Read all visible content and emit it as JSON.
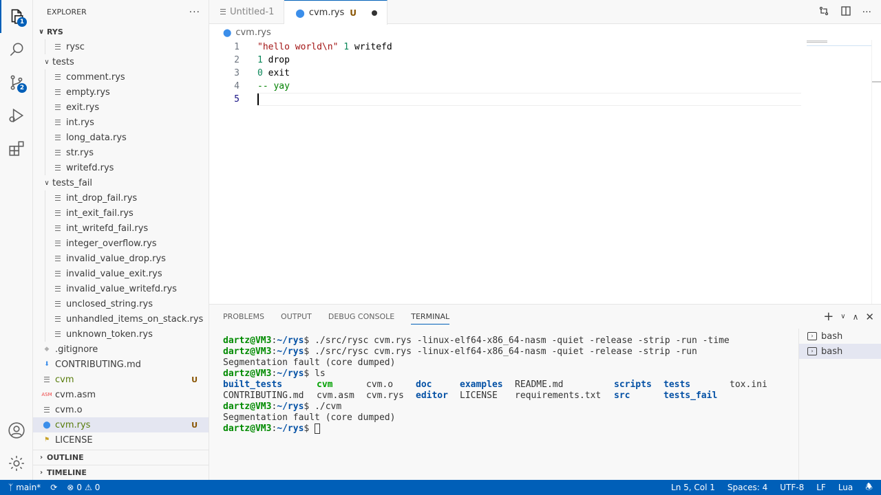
{
  "activity": {
    "explorer_badge": "1",
    "scm_badge": "2"
  },
  "sidebar": {
    "title": "EXPLORER",
    "more": "···",
    "root": "RYS",
    "items": [
      {
        "name": "rysc",
        "depth": 1,
        "kind": "file",
        "icon": "lines"
      },
      {
        "name": "tests",
        "depth": 0,
        "kind": "folder",
        "open": true
      },
      {
        "name": "comment.rys",
        "depth": 1,
        "kind": "file",
        "icon": "lines"
      },
      {
        "name": "empty.rys",
        "depth": 1,
        "kind": "file",
        "icon": "lines"
      },
      {
        "name": "exit.rys",
        "depth": 1,
        "kind": "file",
        "icon": "lines"
      },
      {
        "name": "int.rys",
        "depth": 1,
        "kind": "file",
        "icon": "lines"
      },
      {
        "name": "long_data.rys",
        "depth": 1,
        "kind": "file",
        "icon": "lines"
      },
      {
        "name": "str.rys",
        "depth": 1,
        "kind": "file",
        "icon": "lines"
      },
      {
        "name": "writefd.rys",
        "depth": 1,
        "kind": "file",
        "icon": "lines"
      },
      {
        "name": "tests_fail",
        "depth": 0,
        "kind": "folder",
        "open": true
      },
      {
        "name": "int_drop_fail.rys",
        "depth": 1,
        "kind": "file",
        "icon": "lines"
      },
      {
        "name": "int_exit_fail.rys",
        "depth": 1,
        "kind": "file",
        "icon": "lines"
      },
      {
        "name": "int_writefd_fail.rys",
        "depth": 1,
        "kind": "file",
        "icon": "lines"
      },
      {
        "name": "integer_overflow.rys",
        "depth": 1,
        "kind": "file",
        "icon": "lines"
      },
      {
        "name": "invalid_value_drop.rys",
        "depth": 1,
        "kind": "file",
        "icon": "lines"
      },
      {
        "name": "invalid_value_exit.rys",
        "depth": 1,
        "kind": "file",
        "icon": "lines"
      },
      {
        "name": "invalid_value_writefd.rys",
        "depth": 1,
        "kind": "file",
        "icon": "lines"
      },
      {
        "name": "unclosed_string.rys",
        "depth": 1,
        "kind": "file",
        "icon": "lines"
      },
      {
        "name": "unhandled_items_on_stack.rys",
        "depth": 1,
        "kind": "file",
        "icon": "lines"
      },
      {
        "name": "unknown_token.rys",
        "depth": 1,
        "kind": "file",
        "icon": "lines"
      },
      {
        "name": ".gitignore",
        "depth": 0,
        "kind": "file",
        "icon": "git"
      },
      {
        "name": "CONTRIBUTING.md",
        "depth": 0,
        "kind": "file",
        "icon": "md"
      },
      {
        "name": "cvm",
        "depth": 0,
        "kind": "file",
        "icon": "lines",
        "badge": "U",
        "untracked": true
      },
      {
        "name": "cvm.asm",
        "depth": 0,
        "kind": "file",
        "icon": "asm"
      },
      {
        "name": "cvm.o",
        "depth": 0,
        "kind": "file",
        "icon": "lines"
      },
      {
        "name": "cvm.rys",
        "depth": 0,
        "kind": "file",
        "icon": "rys",
        "badge": "U",
        "untracked": true,
        "selected": true
      },
      {
        "name": "LICENSE",
        "depth": 0,
        "kind": "file",
        "icon": "license"
      }
    ],
    "asm_icon_text": "ASM",
    "outline": "OUTLINE",
    "timeline": "TIMELINE"
  },
  "tabs": [
    {
      "label": "Untitled-1",
      "active": false
    },
    {
      "label": "cvm.rys",
      "active": true,
      "badge": "U",
      "dirty": true
    }
  ],
  "breadcrumb": "cvm.rys",
  "editor": {
    "current_line": 5,
    "lines": [
      {
        "n": "1",
        "tokens": [
          {
            "t": "\"hello world\\n\"",
            "c": "str"
          },
          {
            "t": " ",
            "c": "plain"
          },
          {
            "t": "1",
            "c": "num"
          },
          {
            "t": " writefd",
            "c": "plain"
          }
        ]
      },
      {
        "n": "2",
        "tokens": [
          {
            "t": "1",
            "c": "num"
          },
          {
            "t": " drop",
            "c": "plain"
          }
        ]
      },
      {
        "n": "3",
        "tokens": [
          {
            "t": "0",
            "c": "num"
          },
          {
            "t": " exit",
            "c": "plain"
          }
        ]
      },
      {
        "n": "4",
        "tokens": [
          {
            "t": "-- yay",
            "c": "cmt"
          }
        ]
      },
      {
        "n": "5",
        "tokens": []
      }
    ]
  },
  "panel": {
    "tabs": [
      "PROBLEMS",
      "OUTPUT",
      "DEBUG CONSOLE",
      "TERMINAL"
    ],
    "active_tab": "TERMINAL",
    "add_label": "+",
    "terminals": [
      "bash",
      "bash"
    ],
    "active_terminal": 1
  },
  "terminal": {
    "prompt_user": "dartz@VM3",
    "prompt_sep": ":",
    "prompt_path": "~/rys",
    "prompt_end": "$ ",
    "lines": [
      {
        "type": "cmd",
        "text": "./src/rysc cvm.rys -linux-elf64-x86_64-nasm -quiet -release -strip -run -time"
      },
      {
        "type": "cmd",
        "text": "./src/rysc cvm.rys -linux-elf64-x86_64-nasm -quiet -release -strip -run"
      },
      {
        "type": "out",
        "text": "Segmentation fault (core dumped)"
      },
      {
        "type": "cmd",
        "text": "ls"
      },
      {
        "type": "ls",
        "cells": [
          {
            "t": "built_tests",
            "c": "dir"
          },
          {
            "t": "cvm",
            "c": "exe"
          },
          {
            "t": "cvm.o",
            "c": "plain"
          },
          {
            "t": "doc",
            "c": "dir"
          },
          {
            "t": "examples",
            "c": "dir"
          },
          {
            "t": "README.md",
            "c": "plain"
          },
          {
            "t": "scripts",
            "c": "dir"
          },
          {
            "t": "tests",
            "c": "dir"
          },
          {
            "t": "tox.ini",
            "c": "plain"
          }
        ]
      },
      {
        "type": "ls",
        "cells": [
          {
            "t": "CONTRIBUTING.md",
            "c": "plain"
          },
          {
            "t": "cvm.asm",
            "c": "plain"
          },
          {
            "t": "cvm.rys",
            "c": "plain"
          },
          {
            "t": "editor",
            "c": "dir"
          },
          {
            "t": "LICENSE",
            "c": "plain"
          },
          {
            "t": "requirements.txt",
            "c": "plain"
          },
          {
            "t": "src",
            "c": "dir"
          },
          {
            "t": "tests_fail",
            "c": "dir"
          },
          {
            "t": "",
            "c": "plain"
          }
        ]
      },
      {
        "type": "cmd",
        "text": "./cvm"
      },
      {
        "type": "out",
        "text": "Segmentation fault (core dumped)"
      },
      {
        "type": "prompt",
        "text": ""
      }
    ]
  },
  "statusbar": {
    "branch": "main*",
    "errors": "0",
    "warnings": "0",
    "position": "Ln 5, Col 1",
    "spaces": "Spaces: 4",
    "encoding": "UTF-8",
    "eol": "LF",
    "language": "Lua"
  },
  "colors": {
    "accent": "#005fb8",
    "untracked": "#587c0c",
    "badge_u": "#895503"
  }
}
